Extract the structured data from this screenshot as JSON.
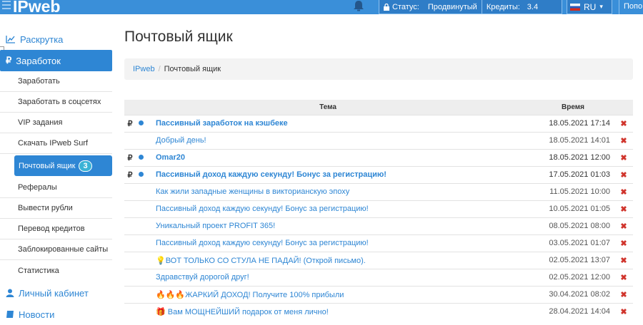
{
  "header": {
    "logo": "IPweb",
    "status_label": "Статус:",
    "status_value": "Продвинутый",
    "credits_label": "Кредиты:",
    "credits_value": "3.4",
    "lang": "RU",
    "topup": "Попо"
  },
  "sidebar": {
    "promo": "Раскрутка",
    "earnings": "Заработок",
    "sub": [
      "Заработать",
      "Заработать в соцсетях",
      "VIP задания",
      "Скачать IPweb Surf",
      "Почтовый ящик",
      "Рефералы",
      "Вывести рубли",
      "Перевод кредитов",
      "Заблокированные сайты",
      "Статистика"
    ],
    "mailbox_badge": "3",
    "cabinet": "Личный кабинет",
    "news": "Новости"
  },
  "page": {
    "title": "Почтовый ящик",
    "breadcrumb_root": "IPweb",
    "breadcrumb_current": "Почтовый ящик"
  },
  "table": {
    "col_subject": "Тема",
    "col_time": "Время",
    "rows": [
      {
        "rub": "₽",
        "dot": true,
        "subject": "Пассивный заработок на кэшбеке",
        "time": "18.05.2021 17:14",
        "unread": true
      },
      {
        "rub": "",
        "dot": false,
        "subject": "Добрый день!",
        "time": "18.05.2021 14:01",
        "unread": false
      },
      {
        "rub": "₽",
        "dot": true,
        "subject": "Omar20",
        "time": "18.05.2021 12:00",
        "unread": true
      },
      {
        "rub": "₽",
        "dot": true,
        "subject": "Пассивный доход каждую секунду! Бонус за регистрацию!",
        "time": "17.05.2021 01:03",
        "unread": true
      },
      {
        "rub": "",
        "dot": false,
        "subject": "Как жили западные женщины в викторианскую эпоху",
        "time": "11.05.2021 10:00",
        "unread": false
      },
      {
        "rub": "",
        "dot": false,
        "subject": "Пассивный доход каждую секунду! Бонус за регистрацию!",
        "time": "10.05.2021 01:05",
        "unread": false
      },
      {
        "rub": "",
        "dot": false,
        "subject": "Уникальный проект PROFIT 365!",
        "time": "08.05.2021 08:00",
        "unread": false
      },
      {
        "rub": "",
        "dot": false,
        "subject": "Пассивный доход каждую секунду! Бонус за регистрацию!",
        "time": "03.05.2021 01:07",
        "unread": false
      },
      {
        "rub": "",
        "dot": false,
        "subject": "💡ВОТ ТОЛЬКО СО СТУЛА НЕ ПАДАЙ! (Открой письмо).",
        "time": "02.05.2021 13:07",
        "unread": false
      },
      {
        "rub": "",
        "dot": false,
        "subject": "Здравствуй дорогой друг!",
        "time": "02.05.2021 12:00",
        "unread": false
      },
      {
        "rub": "",
        "dot": false,
        "subject": "🔥🔥🔥ЖАРКИЙ ДОХОД! Получите 100% прибыли",
        "time": "30.04.2021 08:02",
        "unread": false
      },
      {
        "rub": "",
        "dot": false,
        "subject": "🎁 Вам МОЩНЕЙШИЙ подарок от меня лично!",
        "time": "28.04.2021 14:04",
        "unread": false
      }
    ],
    "delete_glyph": "✖"
  },
  "colors": {
    "accent": "#2e86d4",
    "delete": "#d0342c",
    "topbar": "#3a8fd9"
  }
}
